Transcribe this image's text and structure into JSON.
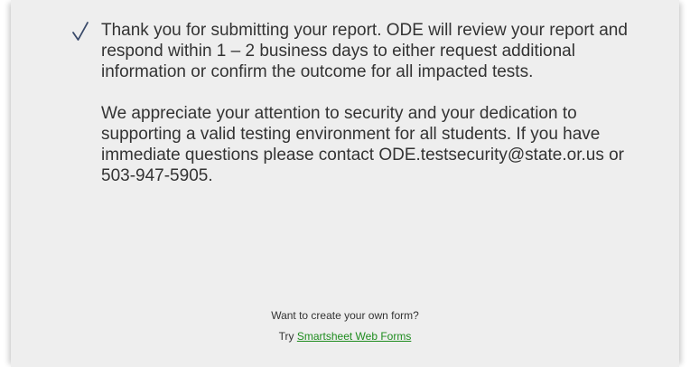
{
  "confirmation": {
    "icon": "checkmark-icon",
    "paragraph_1": "Thank you for submitting your report. ODE will review your report and respond within 1 – 2 business days to either request additional information or confirm the outcome for all impacted tests.",
    "paragraph_2": "We appreciate your attention to security and your dedication to supporting a valid testing environment for all students. If you have immediate questions please contact ODE.testsecurity@state.or.us or 503-947-5905."
  },
  "footer": {
    "prompt": "Want to create your own form?",
    "try_label": "Try",
    "link_label": "Smartsheet Web Forms",
    "link_color": "#1e8c1e"
  },
  "colors": {
    "panel_bg": "#eeeeee",
    "text": "#333333",
    "check": "#3a4a6a"
  }
}
